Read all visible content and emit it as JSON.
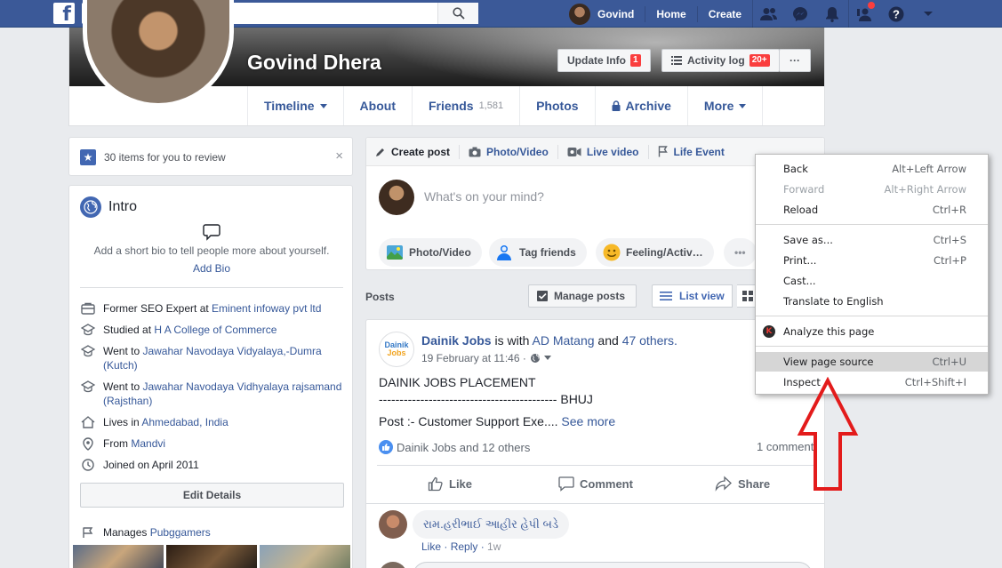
{
  "topbar": {
    "logo": "f",
    "search_value": "Govind Dhera",
    "user_name": "Govind",
    "nav_home": "Home",
    "nav_create": "Create"
  },
  "profile": {
    "name": "Govind Dhera",
    "update_info_label": "Update Info",
    "update_info_badge": "1",
    "activity_log_label": "Activity log",
    "activity_log_badge": "20+",
    "more_dots": "···"
  },
  "tabs": {
    "timeline": "Timeline",
    "about": "About",
    "friends": "Friends",
    "friends_count": "1,581",
    "photos": "Photos",
    "archive": "Archive",
    "more": "More"
  },
  "review": {
    "text": "30 items for you to review",
    "close": "×"
  },
  "intro": {
    "title": "Intro",
    "bio_prompt": "Add a short bio to tell people more about yourself.",
    "add_bio": "Add Bio",
    "items": [
      {
        "pre": "Former SEO Expert at ",
        "link": "Eminent infoway pvt ltd",
        "post": ""
      },
      {
        "pre": "Studied at ",
        "link": "H A College of Commerce",
        "post": ""
      },
      {
        "pre": "Went to ",
        "link": "Jawahar Navodaya Vidyalaya,-Dumra (Kutch)",
        "post": ""
      },
      {
        "pre": "Went to ",
        "link": "Jawahar Navodaya Vidhyalaya rajsamand (Rajsthan)",
        "post": ""
      },
      {
        "pre": "Lives in ",
        "link": "Ahmedabad, India",
        "post": ""
      },
      {
        "pre": "From ",
        "link": "Mandvi",
        "post": ""
      },
      {
        "pre": "Joined on April 2011",
        "link": "",
        "post": ""
      }
    ],
    "edit_details": "Edit Details",
    "manages_pre": "Manages ",
    "manages_link": "Pubggamers"
  },
  "composer": {
    "tab_create": "Create post",
    "tab_photo": "Photo/Video",
    "tab_live": "Live video",
    "tab_life": "Life Event",
    "placeholder": "What's on your mind?",
    "pill_photo": "Photo/Video",
    "pill_tag": "Tag friends",
    "pill_feeling": "Feeling/Activ…",
    "pill_more": "•••"
  },
  "posts_bar": {
    "label": "Posts",
    "manage": "Manage posts",
    "list_view": "List view"
  },
  "post": {
    "logo_line1": "Dainik",
    "logo_line2": "Jobs",
    "author": "Dainik Jobs",
    "with_text": " is with ",
    "with_name": "AD Matang",
    "and_text": " and ",
    "others": "47 others.",
    "time": "19 February at 11:46 ·",
    "line1": "DAINIK JOBS PLACEMENT",
    "line2": "------------------------------------------- BHUJ",
    "line3": "Post :- Customer Support Exe.... ",
    "see_more": "See more",
    "reactions": "Dainik Jobs and 12 others",
    "comment_count": "1 comment",
    "like": "Like",
    "comment": "Comment",
    "share": "Share",
    "c_text": "રામ.હરીભાઈ આહીર હેપી બડે",
    "c_like": "Like",
    "c_reply": "Reply",
    "c_time": "1w"
  },
  "context_menu": {
    "items": [
      {
        "label": "Back",
        "shortcut": "Alt+Left Arrow"
      },
      {
        "label": "Forward",
        "shortcut": "Alt+Right Arrow"
      },
      {
        "label": "Reload",
        "shortcut": "Ctrl+R"
      },
      {
        "label": "Save as...",
        "shortcut": "Ctrl+S"
      },
      {
        "label": "Print...",
        "shortcut": "Ctrl+P"
      },
      {
        "label": "Cast...",
        "shortcut": ""
      },
      {
        "label": "Translate to English",
        "shortcut": ""
      },
      {
        "label": "Analyze this page",
        "shortcut": ""
      },
      {
        "label": "View page source",
        "shortcut": "Ctrl+U"
      },
      {
        "label": "Inspect",
        "shortcut": "Ctrl+Shift+I"
      }
    ],
    "ext_icon_letter": "K"
  },
  "colors": {
    "brand": "#3b5998",
    "link": "#365899",
    "badge": "#fa3e3e",
    "arrow": "#e31b1b"
  }
}
